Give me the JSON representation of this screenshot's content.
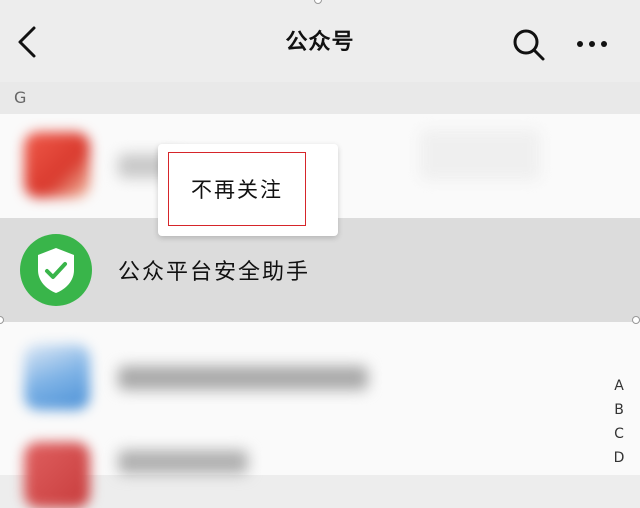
{
  "header": {
    "title": "公众号",
    "back_icon": "chevron-left-icon",
    "search_icon": "search-icon",
    "more_icon": "more-horizontal-icon"
  },
  "section": {
    "letter": "G"
  },
  "rows": [
    {
      "name": "",
      "avatar": "blurred-red-avatar"
    },
    {
      "name": "公众平台安全助手",
      "avatar": "green-shield-check-icon"
    },
    {
      "name": "",
      "avatar": "blurred-blue-avatar"
    },
    {
      "name": "",
      "avatar": "blurred-red-avatar"
    }
  ],
  "context_menu": {
    "items": [
      "不再关注"
    ]
  },
  "index_bar": {
    "letters": [
      "A",
      "B",
      "C",
      "D"
    ]
  },
  "colors": {
    "accent_green": "#39b54a",
    "highlight_border": "#d6252a",
    "selected_row": "#dcdcdc"
  }
}
